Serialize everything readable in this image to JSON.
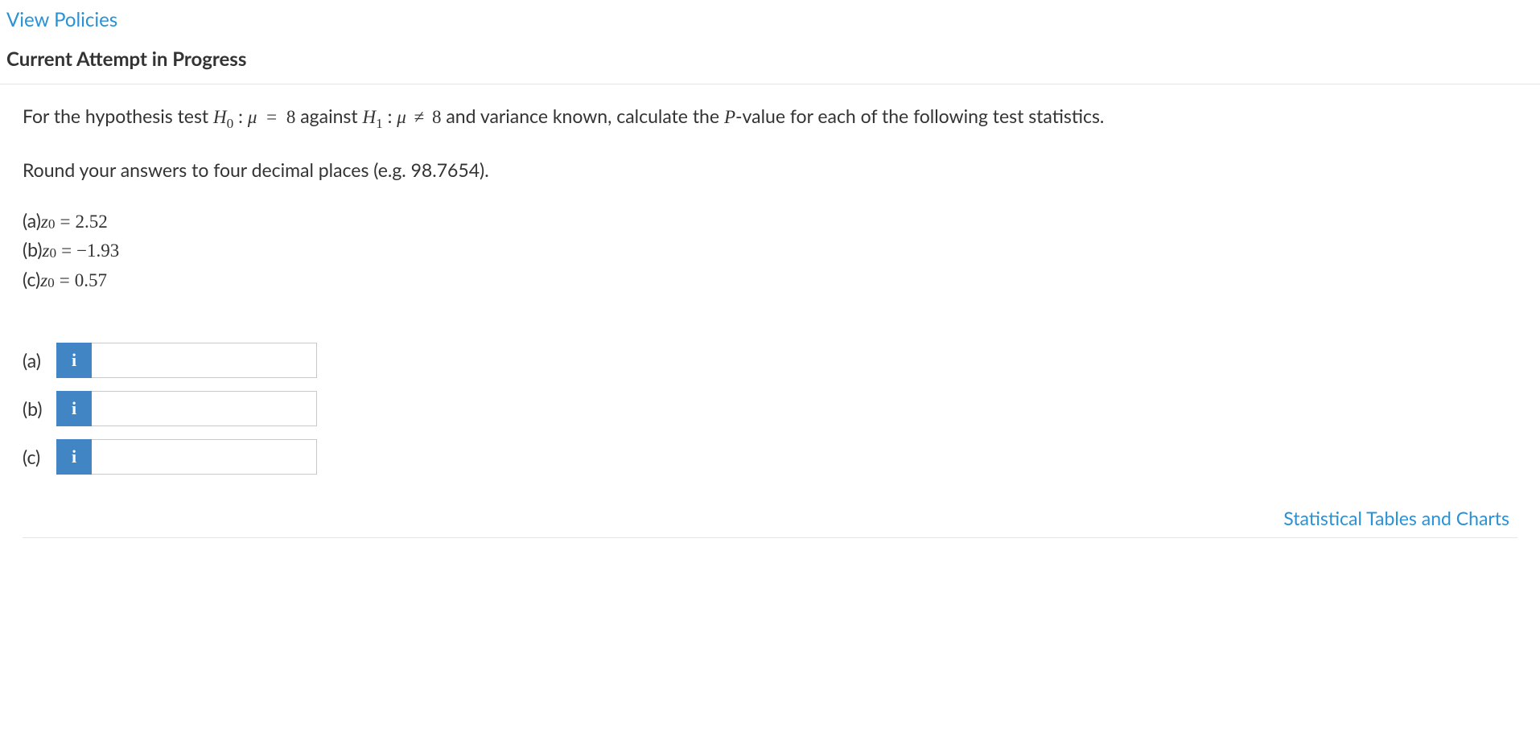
{
  "links": {
    "view_policies": "View Policies",
    "stat_tables": "Statistical Tables and Charts"
  },
  "heading": "Current Attempt in Progress",
  "prompt": {
    "pre": "For the hypothesis test ",
    "h0_label": "H",
    "h0_sub": "0",
    "colon": " : ",
    "mu": "μ",
    "eq": " = ",
    "val8a": "8",
    "against": " against ",
    "h1_label": "H",
    "h1_sub": "1",
    "neq": "≠",
    "val8b": "8",
    "post": " and variance known, calculate the ",
    "pval_p": "P",
    "pval_rest": "-value for each of the following test statistics."
  },
  "round_instruction": "Round your answers to four decimal places (e.g. 98.7654).",
  "stats": [
    {
      "label": "(a) ",
      "var": "z",
      "sub": "0",
      "eq": " = ",
      "val": "2.52"
    },
    {
      "label": "(b) ",
      "var": "z",
      "sub": "0",
      "eq": " = ",
      "val": "−1.93"
    },
    {
      "label": "(c) ",
      "var": "z",
      "sub": "0",
      "eq": " = ",
      "val": "0.57"
    }
  ],
  "answers": [
    {
      "label": "(a)",
      "icon": "i",
      "value": ""
    },
    {
      "label": "(b)",
      "icon": "i",
      "value": ""
    },
    {
      "label": "(c)",
      "icon": "i",
      "value": ""
    }
  ]
}
